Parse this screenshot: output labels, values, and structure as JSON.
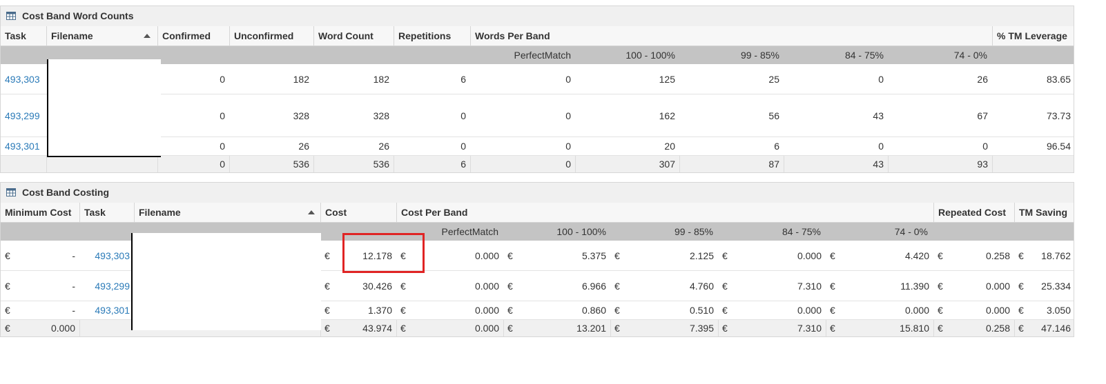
{
  "panel1": {
    "title": "Cost Band Word Counts",
    "headers": {
      "task": "Task",
      "filename": "Filename",
      "confirmed": "Confirmed",
      "unconfirmed": "Unconfirmed",
      "word_count": "Word Count",
      "repetitions": "Repetitions",
      "words_per_band": "Words Per Band",
      "tm_leverage": "% TM Leverage"
    },
    "bands": [
      "PerfectMatch",
      "100 - 100%",
      "99 - 85%",
      "84 - 75%",
      "74 - 0%"
    ],
    "rows": [
      {
        "task": "493,303",
        "confirmed": "0",
        "unconfirmed": "182",
        "word_count": "182",
        "repetitions": "6",
        "b1": "0",
        "b2": "125",
        "b3": "25",
        "b4": "0",
        "b5": "26",
        "leverage": "83.65"
      },
      {
        "task": "493,299",
        "confirmed": "0",
        "unconfirmed": "328",
        "word_count": "328",
        "repetitions": "0",
        "b1": "0",
        "b2": "162",
        "b3": "56",
        "b4": "43",
        "b5": "67",
        "leverage": "73.73"
      },
      {
        "task": "493,301",
        "confirmed": "0",
        "unconfirmed": "26",
        "word_count": "26",
        "repetitions": "0",
        "b1": "0",
        "b2": "20",
        "b3": "6",
        "b4": "0",
        "b5": "0",
        "leverage": "96.54"
      }
    ],
    "total": {
      "confirmed": "0",
      "unconfirmed": "536",
      "word_count": "536",
      "repetitions": "6",
      "b1": "0",
      "b2": "307",
      "b3": "87",
      "b4": "43",
      "b5": "93"
    }
  },
  "panel2": {
    "title": "Cost Band Costing",
    "currency": "€",
    "headers": {
      "minimum_cost": "Minimum Cost",
      "task": "Task",
      "filename": "Filename",
      "cost": "Cost",
      "cost_per_band": "Cost Per Band",
      "repeated_cost": "Repeated Cost",
      "tm_saving": "TM Saving"
    },
    "bands": [
      "PerfectMatch",
      "100 - 100%",
      "99 - 85%",
      "84 - 75%",
      "74 - 0%"
    ],
    "rows": [
      {
        "min": "-",
        "task": "493,303",
        "cost": "12.178",
        "b1": "0.000",
        "b2": "5.375",
        "b3": "2.125",
        "b4": "0.000",
        "b5": "4.420",
        "repeated": "0.258",
        "saving": "18.762"
      },
      {
        "min": "-",
        "task": "493,299",
        "cost": "30.426",
        "b1": "0.000",
        "b2": "6.966",
        "b3": "4.760",
        "b4": "7.310",
        "b5": "11.390",
        "repeated": "0.000",
        "saving": "25.334"
      },
      {
        "min": "-",
        "task": "493,301",
        "cost": "1.370",
        "b1": "0.000",
        "b2": "0.860",
        "b3": "0.510",
        "b4": "0.000",
        "b5": "0.000",
        "repeated": "0.000",
        "saving": "3.050"
      }
    ],
    "total": {
      "min": "0.000",
      "cost": "43.974",
      "b1": "0.000",
      "b2": "13.201",
      "b3": "7.395",
      "b4": "7.310",
      "b5": "15.810",
      "repeated": "0.258",
      "saving": "47.146"
    }
  },
  "colors": {
    "link": "#2a7ab8",
    "highlight": "#e02424",
    "band_header": "#c4c4c4"
  },
  "icons": {
    "panel_title": "table-grid-icon",
    "sort": "sort-ascending-icon"
  }
}
